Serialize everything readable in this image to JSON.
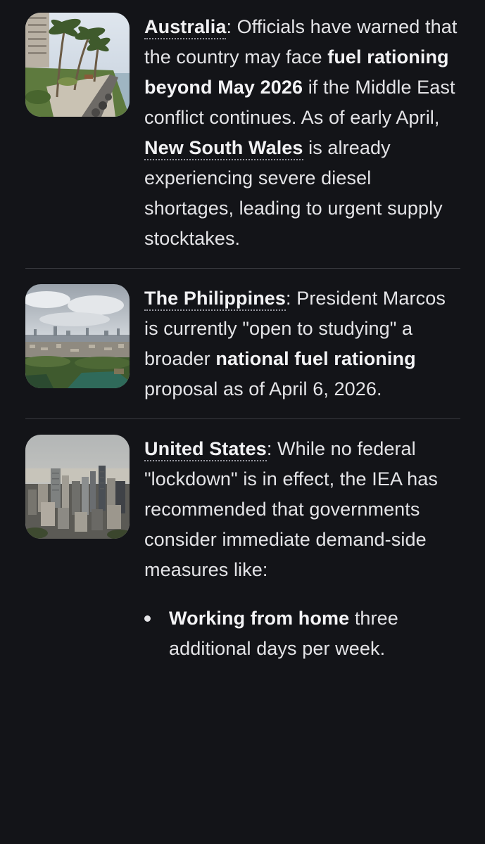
{
  "items": [
    {
      "image_name": "coastal-promenade-photo",
      "link": "Australia",
      "t1": ": Officials have warned that the country may face ",
      "b1": "fuel rationing beyond May 2026",
      "t2": " if the Middle East conflict continues. As of early April, ",
      "link2": "New South Wales",
      "t3": " is already experiencing severe diesel shortages, leading to urgent supply stocktakes."
    },
    {
      "image_name": "city-skyline-photo",
      "link": "The Philippines",
      "t1": ": President Marcos is currently \"open to studying\" a broader ",
      "b1": "national fuel rationing",
      "t2": " proposal as of April 6, 2026."
    },
    {
      "image_name": "downtown-aerial-photo",
      "link": "United States",
      "t1": ": While no federal \"lockdown\" is in effect, the IEA has recommended that governments consider immediate demand-side measures like:",
      "bullets": [
        {
          "bold": "Working from home",
          "text": " three additional days per week."
        }
      ]
    }
  ]
}
